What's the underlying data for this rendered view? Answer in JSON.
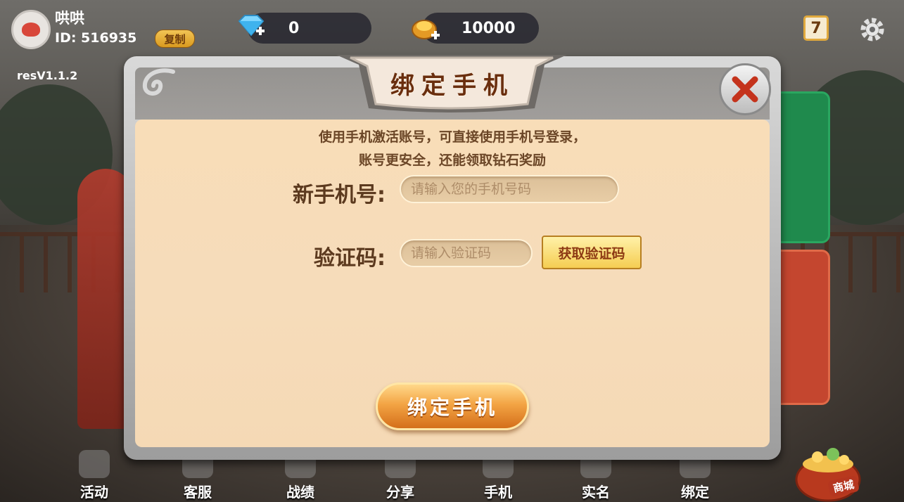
{
  "user": {
    "name": "哄哄",
    "id_label": "ID: 516935",
    "copy_label": "复制"
  },
  "resources": {
    "diamond_value": "0",
    "gold_value": "10000"
  },
  "version": "resV1.1.2",
  "calendar_day": "7",
  "dialog": {
    "title": "绑定手机",
    "desc_line1": "使用手机激活账号，可直接使用手机号登录，",
    "desc_line2": "账号更安全，还能领取钻石奖励",
    "phone_label": "新手机号:",
    "phone_placeholder": "请输入您的手机号码",
    "code_label": "验证码:",
    "code_placeholder": "请输入验证码",
    "get_code_label": "获取验证码",
    "bind_label": "绑定手机"
  },
  "nav": {
    "items": [
      {
        "label": "活动",
        "icon": "gift-icon"
      },
      {
        "label": "客服",
        "icon": "headset-icon"
      },
      {
        "label": "战绩",
        "icon": "trophy-icon"
      },
      {
        "label": "分享",
        "icon": "share-icon"
      },
      {
        "label": "手机",
        "icon": "phone-icon"
      },
      {
        "label": "实名",
        "icon": "verified-user-icon"
      },
      {
        "label": "绑定",
        "icon": "bind-card-icon"
      }
    ],
    "shop_label": "商城"
  },
  "colors": {
    "dialog_bg": "#f8ddb8",
    "button_orange": "#f3a444",
    "title_brown": "#6a2e0e",
    "close_red": "#c4331c"
  }
}
